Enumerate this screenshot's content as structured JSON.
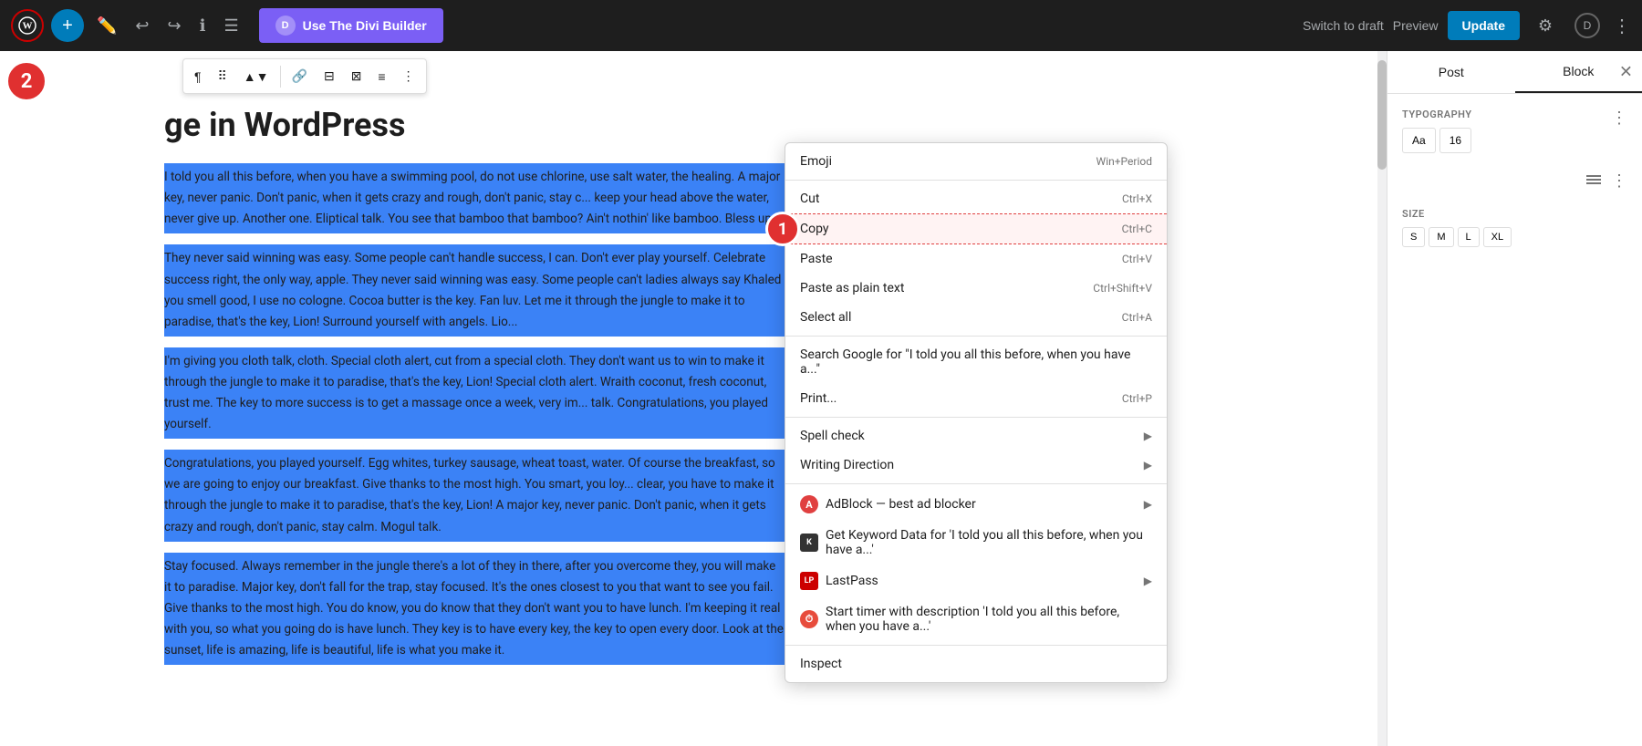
{
  "topbar": {
    "add_button": "+",
    "divi_button_label": "Use The Divi Builder",
    "divi_logo": "D",
    "switch_draft": "Switch to draft",
    "preview": "Preview",
    "update": "Update"
  },
  "editor": {
    "title": "ge in WordPress",
    "paragraphs": [
      "I told you all this before, when you have a swimming pool, do not use chlorine, use salt water, the healing. A major key, never panic. Don't panic, when it gets crazy and rough, don't panic, stay c... keep your head above the water, never give up. Another one. Eliptical talk. You see that bamboo that bamboo? Ain't nothin' like bamboo. Bless up.",
      "They never said winning was easy. Some people can't handle success, I can. Don't ever play yourself. Celebrate success right, the only way, apple. They never said winning was easy. Some people can't ladies always say Khaled you smell good, I use no cologne. Cocoa butter is the key. Fan luv. Let me it through the jungle to make it to paradise, that's the key, Lion! Surround yourself with angels. Lio...",
      "I'm giving you cloth talk, cloth. Special cloth alert, cut from a special cloth. They don't want us to win to make it through the jungle to make it to paradise, that's the key, Lion! Special cloth alert. Wraith coconut, fresh coconut, trust me. The key to more success is to get a massage once a week, very im... talk. Congratulations, you played yourself.",
      "Congratulations, you played yourself. Egg whites, turkey sausage, wheat toast, water. Of course the breakfast, so we are going to enjoy our breakfast. Give thanks to the most high. You smart, you loy... clear, you have to make it through the jungle to make it to paradise, that's the key, Lion! A major key, never panic. Don't panic, when it gets crazy and rough, don't panic, stay calm. Mogul talk.",
      "Stay focused. Always remember in the jungle there's a lot of they in there, after you overcome they, you will make it to paradise. Major key, don't fall for the trap, stay focused. It's the ones closest to you that want to see you fail. Give thanks to the most high. You do know, you do know that they don't want you to have lunch. I'm keeping it real with you, so what you going do is have lunch. They key is to have every key, the key to open every door. Look at the sunset, life is amazing, life is beautiful, life is what you make it."
    ]
  },
  "context_menu": {
    "items": [
      {
        "label": "Emoji",
        "shortcut": "Win+Period",
        "has_arrow": false,
        "icon": null
      },
      {
        "label": "Cut",
        "shortcut": "Ctrl+X",
        "has_arrow": false,
        "icon": null
      },
      {
        "label": "Copy",
        "shortcut": "Ctrl+C",
        "has_arrow": false,
        "icon": null,
        "highlighted": true
      },
      {
        "label": "Paste",
        "shortcut": "Ctrl+V",
        "has_arrow": false,
        "icon": null
      },
      {
        "label": "Paste as plain text",
        "shortcut": "Ctrl+Shift+V",
        "has_arrow": false,
        "icon": null
      },
      {
        "label": "Select all",
        "shortcut": "Ctrl+A",
        "has_arrow": false,
        "icon": null
      },
      {
        "label": "Search Google for “I told you all this before, when you have a...”",
        "shortcut": "",
        "has_arrow": false,
        "icon": null
      },
      {
        "label": "Print...",
        "shortcut": "Ctrl+P",
        "has_arrow": false,
        "icon": null
      },
      {
        "label": "Spell check",
        "shortcut": "",
        "has_arrow": true,
        "icon": null
      },
      {
        "label": "Writing Direction",
        "shortcut": "",
        "has_arrow": true,
        "icon": null
      },
      {
        "label": "AdBlock — best ad blocker",
        "shortcut": "",
        "has_arrow": true,
        "icon": "adblock"
      },
      {
        "label": "Get Keyword Data for 'I told you all this before, when you have a...'",
        "shortcut": "",
        "has_arrow": false,
        "icon": "keyword"
      },
      {
        "label": "LastPass",
        "shortcut": "",
        "has_arrow": true,
        "icon": "lastpass"
      },
      {
        "label": "Start timer with description 'I told you all this before, when you have a...'",
        "shortcut": "",
        "has_arrow": false,
        "icon": "timer"
      },
      {
        "label": "Inspect",
        "shortcut": "",
        "has_arrow": false,
        "icon": null
      }
    ]
  },
  "sidebar": {
    "tab_post": "Post",
    "tab_block": "Block",
    "size_options": [
      "S",
      "M",
      "L",
      "XL"
    ]
  },
  "badges": {
    "badge1": "1",
    "badge2": "2"
  }
}
